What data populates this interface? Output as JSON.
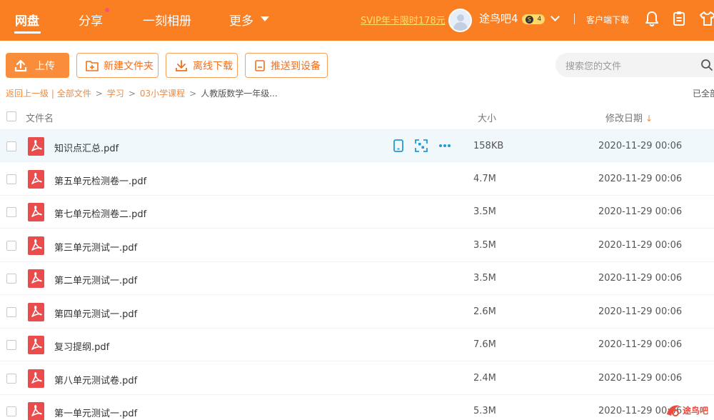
{
  "topnav": {
    "items": [
      {
        "label": "网盘"
      },
      {
        "label": "分享"
      },
      {
        "label": "一刻相册"
      },
      {
        "label": "更多"
      }
    ],
    "svip_promo": "SVIP年卡限时178元",
    "username": "途鸟吧4",
    "badge_s": "S",
    "badge_level": "4",
    "client_download": "客户端下载"
  },
  "toolbar": {
    "upload": "上传",
    "new_folder": "新建文件夹",
    "offline_download": "离线下载",
    "push_device": "推送到设备"
  },
  "search": {
    "placeholder": "搜索您的文件"
  },
  "breadcrumb": {
    "back": "返回上一级",
    "divider": "|",
    "items": [
      "全部文件",
      "学习",
      "03小学课程"
    ],
    "current": "人教版数学一年级...",
    "loaded_status": "已全部"
  },
  "table": {
    "headers": {
      "name": "文件名",
      "size": "大小",
      "date": "修改日期",
      "sort_arrow": "↓"
    },
    "rows": [
      {
        "name": "知识点汇总.pdf",
        "size": "158KB",
        "date": "2020-11-29 00:06"
      },
      {
        "name": "第五单元检测卷一.pdf",
        "size": "4.7M",
        "date": "2020-11-29 00:06"
      },
      {
        "name": "第七单元检测卷二.pdf",
        "size": "3.5M",
        "date": "2020-11-29 00:06"
      },
      {
        "name": "第三单元测试一.pdf",
        "size": "3.5M",
        "date": "2020-11-29 00:06"
      },
      {
        "name": "第二单元测试一.pdf",
        "size": "3.5M",
        "date": "2020-11-29 00:06"
      },
      {
        "name": "第四单元测试一.pdf",
        "size": "2.6M",
        "date": "2020-11-29 00:06"
      },
      {
        "name": "复习提纲.pdf",
        "size": "7.6M",
        "date": "2020-11-29 00:06"
      },
      {
        "name": "第八单元测试卷.pdf",
        "size": "2.4M",
        "date": "2020-11-29 00:06"
      },
      {
        "name": "第一单元测试一.pdf",
        "size": "5.3M",
        "date": "2020-11-29 00:06"
      }
    ]
  },
  "watermark": "途鸟吧",
  "colors": {
    "brand_orange": "#fa7f22",
    "svip_yellow": "#ffe169",
    "pdf_red": "#ea4b4b",
    "action_blue": "#1f9ad6",
    "row_highlight": "#f1f8fc"
  },
  "icons": {
    "upload": "upload-icon",
    "new_folder": "folder-plus-icon",
    "download": "download-icon",
    "push": "device-icon",
    "search": "search-icon",
    "bell": "bell-icon",
    "clipboard": "clipboard-icon",
    "shirt": "shirt-icon",
    "pdf": "pdf-file-icon",
    "phone": "phone-icon",
    "qr": "qr-scan-icon",
    "more": "more-dots-icon"
  }
}
